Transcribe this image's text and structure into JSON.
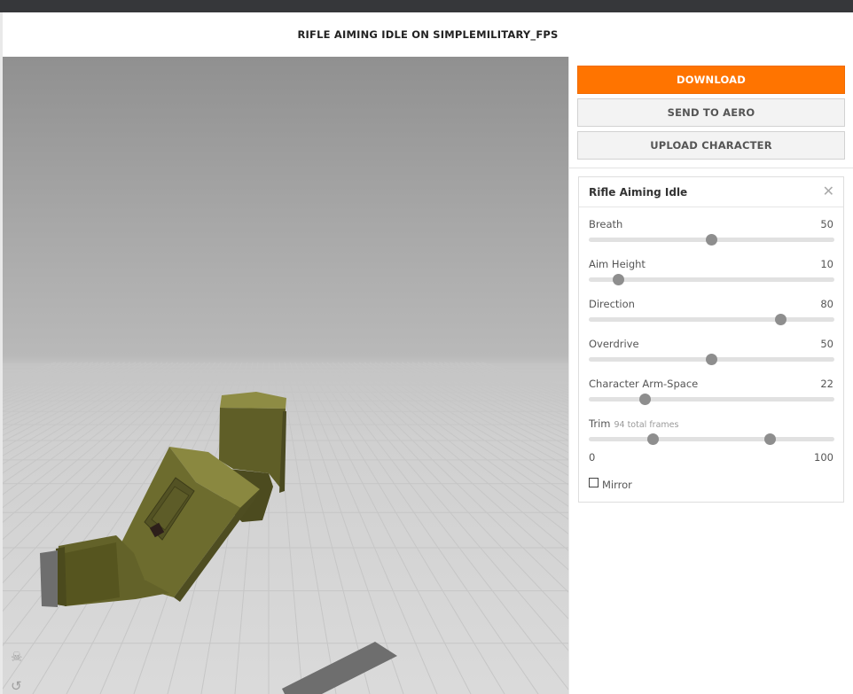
{
  "header": {
    "title": "RIFLE AIMING IDLE ON SIMPLEMILITARY_FPS"
  },
  "actions": {
    "download": "DOWNLOAD",
    "send_to_aero": "SEND TO AERO",
    "upload_character": "UPLOAD CHARACTER"
  },
  "settings": {
    "title": "Rifle Aiming Idle",
    "close_icon": "close-icon",
    "sliders": [
      {
        "label": "Breath",
        "value": "50",
        "fraction": 0.5
      },
      {
        "label": "Aim Height",
        "value": "10",
        "fraction": 0.12
      },
      {
        "label": "Direction",
        "value": "80",
        "fraction": 0.78
      },
      {
        "label": "Overdrive",
        "value": "50",
        "fraction": 0.5
      },
      {
        "label": "Character Arm-Space",
        "value": "22",
        "fraction": 0.23
      }
    ],
    "trim": {
      "label": "Trim",
      "sublabel": "94 total frames",
      "min_label": "0",
      "max_label": "100",
      "start_fraction": 0.26,
      "end_fraction": 0.74
    },
    "mirror": {
      "label": "Mirror",
      "checked": false
    }
  },
  "viewport": {
    "icons": [
      "skull-icon",
      "rotate-icon"
    ]
  },
  "colors": {
    "accent": "#ff7400",
    "topbar": "#36373a",
    "model_olive": "#6b6a2e"
  }
}
